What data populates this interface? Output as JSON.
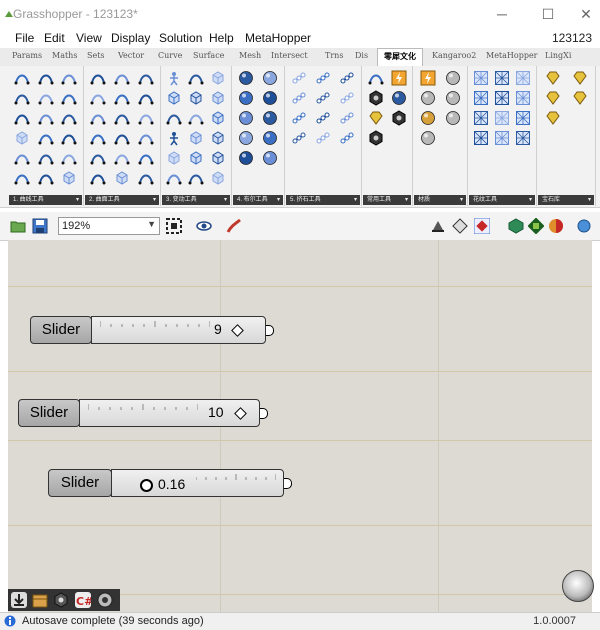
{
  "window": {
    "title": "Grasshopper - 123123*",
    "minimize": "─",
    "maximize": "☐",
    "close": "✕"
  },
  "menu": {
    "items": [
      "File",
      "Edit",
      "View",
      "Display",
      "Solution",
      "Help",
      "MetaHopper"
    ],
    "document_name": "123123"
  },
  "tabs": [
    "Params",
    "Maths",
    "Sets",
    "Vector",
    "Curve",
    "Surface",
    "Mesh",
    "Intersect",
    "Trns",
    "Dis",
    "零犀文化",
    "Kangaroo2",
    "MetaHopper",
    "LingXi"
  ],
  "active_tab": "零犀文化",
  "panels": [
    {
      "label": "1. 曲线工具",
      "icons": [
        "curve-tool-icon",
        "arc-tool-icon",
        "crescent-icon",
        "spline-icon",
        "node-curve-icon",
        "blob-icon",
        "spectrum-curve-icon",
        "freeform-icon",
        "surface-patch-icon",
        "box-frame-icon",
        "grid-points-icon",
        "cross-shape-icon",
        "target-icon",
        "plane-icon",
        "crescent-icon",
        "spiral-icon",
        "g-curve-icon",
        "box-3d-icon"
      ]
    },
    {
      "label": "2. 曲面工具",
      "icons": [
        "network-icon",
        "fabric-icon",
        "half-cylinder-icon",
        "scatter-dots-icon",
        "surface-icon",
        "cylinder-icon",
        "wave-surface-icon",
        "loft-icon",
        "arch-icon",
        "points-icon",
        "frame-icon",
        "shell-icon",
        "twisted-surface-icon",
        "crescent-icon",
        "panel-icon",
        "pipe-icon",
        "box-icon",
        "arch-icon"
      ]
    },
    {
      "label": "3. 变动工具",
      "icons": [
        "gear-person-icon",
        "move-arrows-icon",
        "measure-box-icon",
        "grid-cube-icon",
        "cube-icon",
        "cube-icon",
        "slice-icon",
        "dots-icon",
        "pyramid-icon",
        "person-icon",
        "box-icon",
        "prism-icon",
        "wireframe-box-icon",
        "cubes-icon",
        "dashed-cube-icon",
        "cross-points-icon",
        "stripes-icon",
        "frustum-icon",
        "tri-cube-icon",
        "boxes-icon",
        "bar-chart-icon"
      ]
    },
    {
      "label": "4. 布尔工具",
      "icons": [
        "circles-icon",
        "sphere-icon",
        "spheres-icon",
        "sphere-icon",
        "spheres-icon",
        "sphere-icon",
        "spheres-icon",
        "sphere-icon",
        "spheres-icon",
        "sphere-icon"
      ]
    },
    {
      "label": "5. 挤石工具",
      "icons": [
        "chain-icon",
        "chain-icon",
        "chain-icon",
        "chain-icon",
        "chain-icon",
        "chain-icon",
        "chain-icon",
        "chain-icon",
        "chain-icon",
        "chain-icon",
        "chain-icon",
        "chain-icon"
      ]
    },
    {
      "label": "常用工具",
      "icons": [
        "gear-dots-icon",
        "lightning-icon",
        "hexagon-icon",
        "ring-icon",
        "gem-icon",
        "cross-hex-icon",
        "nut-icon"
      ]
    },
    {
      "label": "材质",
      "icons": [
        "image-icon",
        "metal-sphere-icon",
        "metal-sphere-icon",
        "chrome-sphere-icon",
        "gold-sphere-icon",
        "metal-sphere-icon",
        "chrome-sphere-icon"
      ]
    },
    {
      "label": "花纹工具",
      "icons": [
        "pattern-icon",
        "grid-pattern-icon",
        "diamond-pattern-icon",
        "mesh-pattern-icon",
        "star-pattern-icon",
        "cross-pattern-icon",
        "lattice-icon",
        "heart-pattern-icon",
        "gem-pattern-icon",
        "snowflake-icon",
        "hex-pattern-icon",
        "weave-icon"
      ]
    },
    {
      "label": "宝石库",
      "icons": [
        "gem-box-icon",
        "gem-half-icon",
        "gem-box-icon",
        "gem-cut-icon",
        "gem-box-icon"
      ]
    }
  ],
  "toolbar": {
    "zoom_value": "192%",
    "zoom_dropdown": "▼"
  },
  "sliders": [
    {
      "label": "Slider",
      "value": "9",
      "grip": "diamond"
    },
    {
      "label": "Slider",
      "value": "10",
      "grip": "diamond"
    },
    {
      "label": "Slider",
      "value": "0.16",
      "grip": "round"
    }
  ],
  "status": {
    "text": "Autosave complete (39 seconds ago)",
    "version": "1.0.0007"
  },
  "colors": {
    "canvas": "#dcdad2",
    "panel_footer": "#3b3b3b",
    "icon_blue": "#3a6fc4"
  }
}
